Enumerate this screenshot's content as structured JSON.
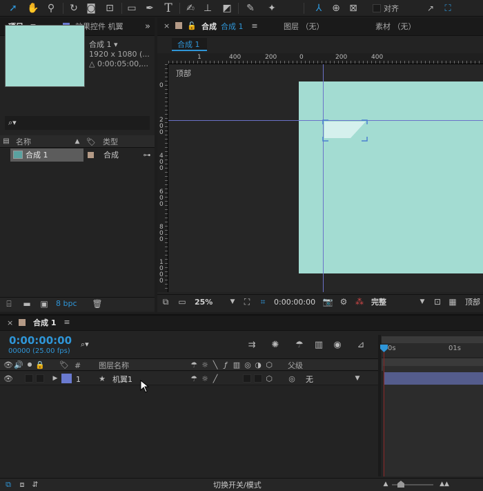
{
  "toolbar": {
    "tools": [
      "selection-tool",
      "hand-tool",
      "zoom-tool",
      "rotate-tool",
      "camera-tool",
      "pan-behind-tool",
      "rectangle-tool",
      "pen-tool",
      "type-tool",
      "brush-tool",
      "clone-stamp-tool",
      "eraser-tool",
      "roto-brush-tool",
      "puppet-tool",
      "axis-local",
      "axis-world",
      "axis-view"
    ],
    "type_glyph": "T",
    "align_label": "对齐"
  },
  "project_panel": {
    "tab_project": "项目",
    "tab_effects": "效果控件 机翼",
    "comp_name": "合成 1 ▾",
    "comp_size": "1920 x 1080 (...",
    "comp_duration": "△ 0:00:05:00,...",
    "search_glyph": "⌕▾",
    "col_name": "名称",
    "col_type": "类型",
    "items": [
      {
        "name": "合成 1",
        "type": "合成"
      }
    ],
    "bpc": "8 bpc"
  },
  "comp_panel": {
    "close_glyph": "×",
    "tab_comp_prefix": "合成",
    "tab_comp_name": "合成 1",
    "tab_layer": "图层 （无）",
    "tab_footage": "素材 （无）",
    "active_comp": "合成 1",
    "view_label": "顶部",
    "ruler_h": [
      "1",
      "400",
      "200",
      "0",
      "200",
      "400"
    ],
    "ruler_v": [
      "0",
      "2\n0\n0",
      "4\n0\n0",
      "6\n0\n0",
      "8\n0\n0",
      "1\n0\n0\n0"
    ],
    "zoom": "25%",
    "timecode": "0:00:00:00",
    "resolution": "完整",
    "bottom_view": "顶部",
    "canvas_color": "#a3dcd2"
  },
  "timeline": {
    "tab_name": "合成 1",
    "current_time": "0:00:00:00",
    "frame_info": "00000 (25.00 fps)",
    "col_num": "#",
    "col_layer_name": "图层名称",
    "col_parent": "父级",
    "layers": [
      {
        "index": "1",
        "name": "机翼1",
        "parent": "无",
        "label_color": "#6a7ad0"
      }
    ],
    "ruler_labels": [
      "0s",
      "01s"
    ],
    "toggle_modes": "切换开关/模式"
  },
  "colors": {
    "accent": "#2f96d8",
    "layer_bar": "#545c8c",
    "playhead": "#8a2323"
  }
}
